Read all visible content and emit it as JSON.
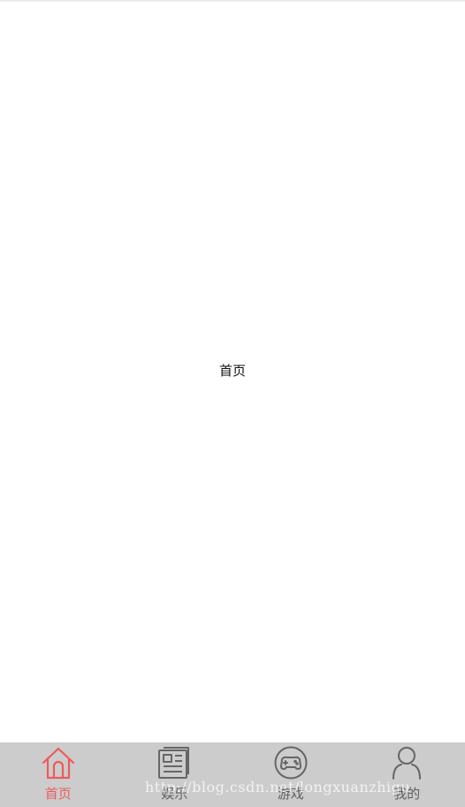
{
  "main": {
    "page_label": "首页"
  },
  "tabbar": {
    "accent_color": "#ee5b5b",
    "inactive_color": "#606060",
    "background": "#cccccc",
    "tabs": [
      {
        "label": "首页",
        "icon": "home-icon",
        "active": true
      },
      {
        "label": "娱乐",
        "icon": "news-icon",
        "active": false
      },
      {
        "label": "游戏",
        "icon": "gamepad-icon",
        "active": false
      },
      {
        "label": "我的",
        "icon": "person-icon",
        "active": false
      }
    ]
  },
  "watermark": {
    "text": "http://blog.csdn.net/longxuanzhigu"
  }
}
